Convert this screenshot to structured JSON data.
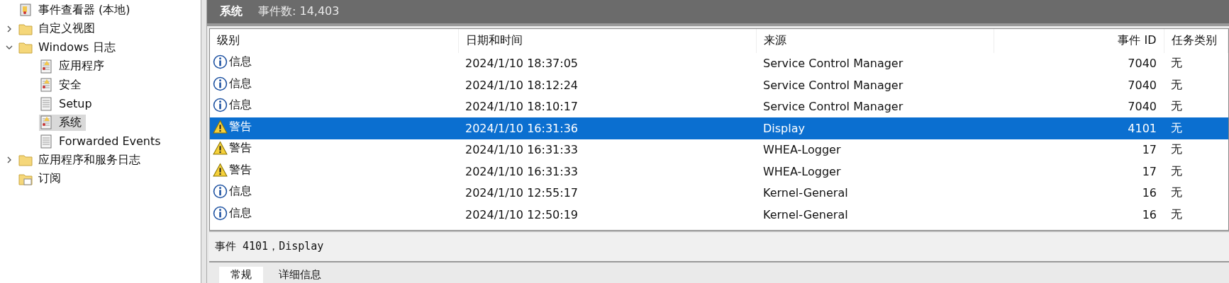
{
  "tree": {
    "root": {
      "label": "事件查看器 (本地)"
    },
    "items": [
      {
        "label": "自定义视图",
        "kind": "folder",
        "expanded": false,
        "selected": false
      },
      {
        "label": "Windows 日志",
        "kind": "folder",
        "expanded": true,
        "selected": false,
        "children": [
          {
            "label": "应用程序",
            "kind": "log",
            "selected": false
          },
          {
            "label": "安全",
            "kind": "log",
            "selected": false
          },
          {
            "label": "Setup",
            "kind": "plainlog",
            "selected": false
          },
          {
            "label": "系统",
            "kind": "log",
            "selected": true
          },
          {
            "label": "Forwarded Events",
            "kind": "plainlog",
            "selected": false
          }
        ]
      },
      {
        "label": "应用程序和服务日志",
        "kind": "folder",
        "expanded": false,
        "selected": false
      },
      {
        "label": "订阅",
        "kind": "subscription",
        "selected": false
      }
    ]
  },
  "header": {
    "title": "系统",
    "count": "事件数: 14,403"
  },
  "table": {
    "columns": [
      "级别",
      "日期和时间",
      "来源",
      "事件 ID",
      "任务类别"
    ],
    "rows": [
      {
        "kind": "info",
        "level": "信息",
        "date": "2024/1/10 18:37:05",
        "source": "Service Control Manager",
        "id": "7040",
        "task": "无",
        "selected": false
      },
      {
        "kind": "info",
        "level": "信息",
        "date": "2024/1/10 18:12:24",
        "source": "Service Control Manager",
        "id": "7040",
        "task": "无",
        "selected": false
      },
      {
        "kind": "info",
        "level": "信息",
        "date": "2024/1/10 18:10:17",
        "source": "Service Control Manager",
        "id": "7040",
        "task": "无",
        "selected": false
      },
      {
        "kind": "warning",
        "level": "警告",
        "date": "2024/1/10 16:31:36",
        "source": "Display",
        "id": "4101",
        "task": "无",
        "selected": true
      },
      {
        "kind": "warning",
        "level": "警告",
        "date": "2024/1/10 16:31:33",
        "source": "WHEA-Logger",
        "id": "17",
        "task": "无",
        "selected": false
      },
      {
        "kind": "warning",
        "level": "警告",
        "date": "2024/1/10 16:31:33",
        "source": "WHEA-Logger",
        "id": "17",
        "task": "无",
        "selected": false
      },
      {
        "kind": "info",
        "level": "信息",
        "date": "2024/1/10 12:55:17",
        "source": "Kernel-General",
        "id": "16",
        "task": "无",
        "selected": false
      },
      {
        "kind": "info",
        "level": "信息",
        "date": "2024/1/10 12:50:19",
        "source": "Kernel-General",
        "id": "16",
        "task": "无",
        "selected": false
      }
    ]
  },
  "detail": {
    "title": "事件 4101，Display",
    "tabs": [
      {
        "label": "常规",
        "selected": true
      },
      {
        "label": "详细信息",
        "selected": false
      }
    ]
  }
}
